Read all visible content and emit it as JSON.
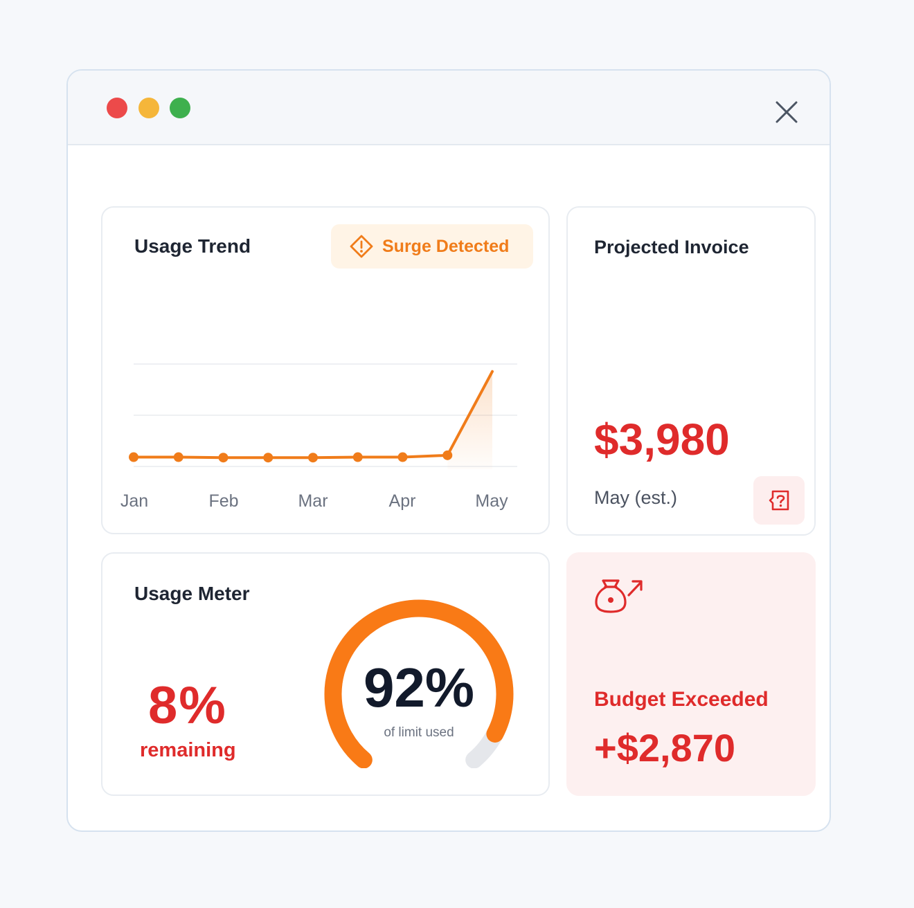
{
  "window": {
    "controls": {
      "close": "close-icon",
      "red": "#ec4a4a",
      "yellow": "#f5b63a",
      "green": "#3eb04e"
    }
  },
  "trend": {
    "title": "Usage Trend",
    "badge": {
      "label": "Surge Detected",
      "icon": "warning-diamond-icon",
      "color": "#f07c1a"
    }
  },
  "chart_data": {
    "type": "line",
    "x_labels": [
      "Jan",
      "Feb",
      "Mar",
      "Apr",
      "May"
    ],
    "series": [
      {
        "values": [
          10,
          10,
          9.5,
          9.5,
          9.5,
          10,
          10,
          12,
          102
        ]
      }
    ],
    "ylim": [
      0,
      110
    ],
    "grid": true,
    "color": "#f07c1a"
  },
  "invoice": {
    "title": "Projected Invoice",
    "amount": "$3,980",
    "period": "May (est.)",
    "help_icon": "question-tag-icon"
  },
  "meter": {
    "title": "Usage Meter",
    "remaining_pct": "8%",
    "remaining_label": "remaining",
    "used_pct": "92%",
    "used_fraction": 0.92,
    "caption": "of limit used",
    "track_color": "#e5e7eb",
    "fill_color": "#f97a16"
  },
  "budget": {
    "icon": "money-bag-up-icon",
    "title": "Budget Exceeded",
    "amount": "+$2,870",
    "color": "#df2b2b"
  }
}
